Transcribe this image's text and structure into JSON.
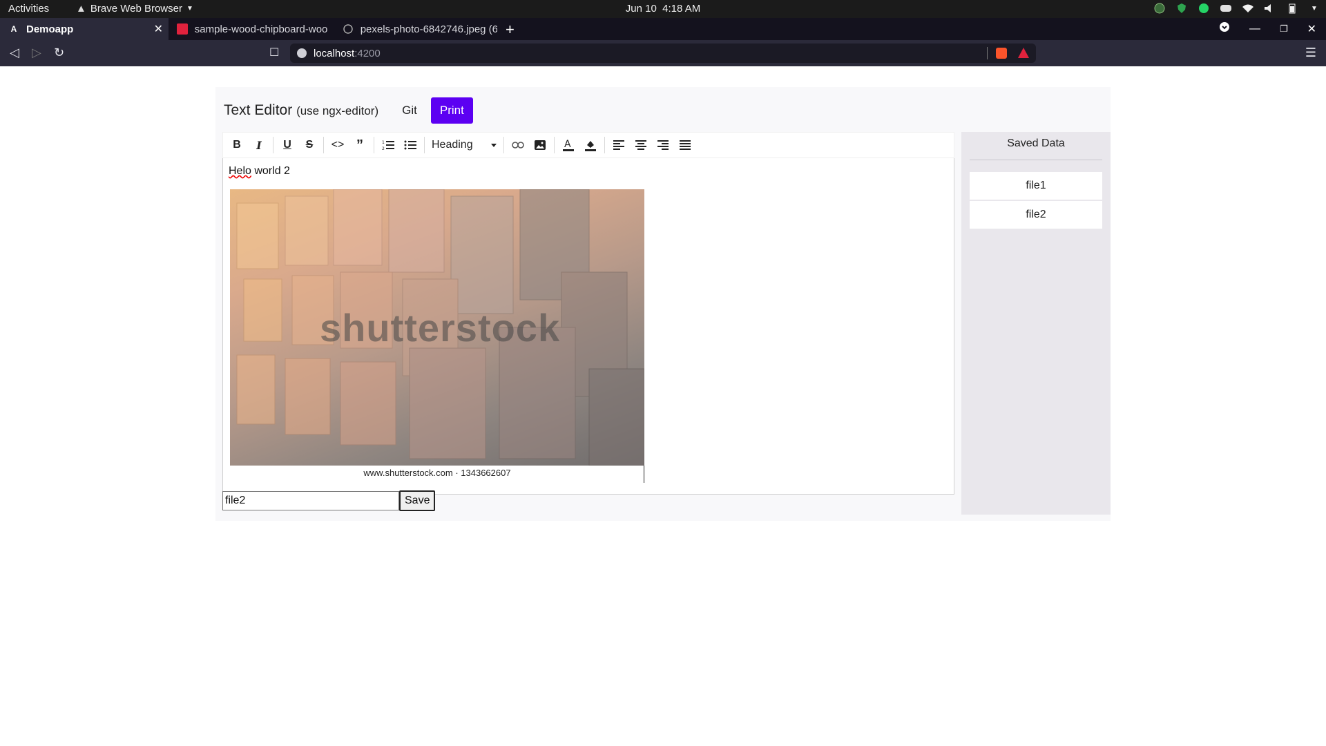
{
  "system": {
    "activities": "Activities",
    "app_menu": "Brave Web Browser",
    "date": "Jun 10",
    "time": "4:18 AM"
  },
  "browser": {
    "tabs": [
      {
        "title": "Demoapp",
        "active": true
      },
      {
        "title": "sample-wood-chipboard-woo",
        "active": false
      },
      {
        "title": "pexels-photo-6842746.jpeg (6",
        "active": false
      }
    ],
    "url_host": "localhost",
    "url_port": ":4200"
  },
  "app": {
    "title": "Text Editor",
    "subtitle": "(use ngx-editor)",
    "git_label": "Git",
    "print_label": "Print"
  },
  "editor": {
    "heading_select": "Heading",
    "paragraph_word1": "Helo",
    "paragraph_rest": " world 2",
    "watermark": "shutterstock",
    "image_credit": "www.shutterstock.com · 1343662607"
  },
  "save_form": {
    "filename_value": "file2",
    "save_label": "Save"
  },
  "saved_panel": {
    "title": "Saved Data",
    "items": [
      "file1",
      "file2"
    ]
  },
  "colors": {
    "accent": "#5c00f2",
    "tab_bg": "#2b2a3a"
  }
}
